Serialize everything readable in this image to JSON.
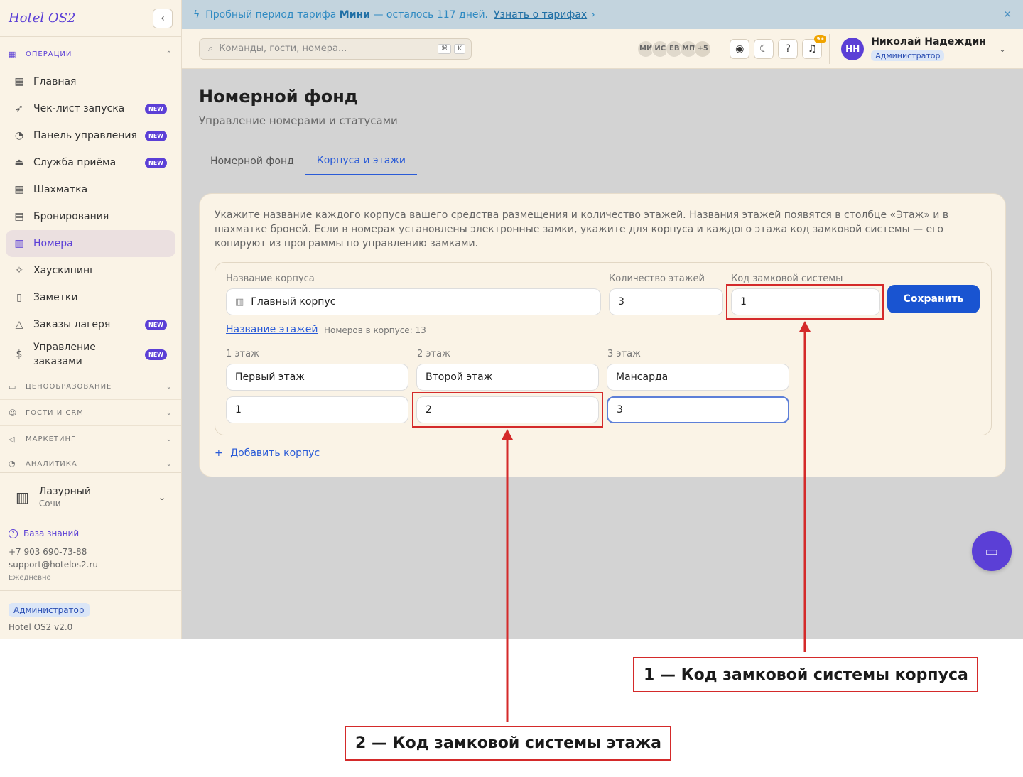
{
  "sidebar": {
    "logo": "Hotel OS2",
    "collapse_icon": "chevron-left-icon",
    "sections": {
      "operations": "ОПЕРАЦИИ",
      "pricing": "ЦЕНООБРАЗОВАНИЕ",
      "guests": "ГОСТИ И CRM",
      "marketing": "МАРКЕТИНГ",
      "analytics": "АНАЛИТИКА"
    },
    "items": [
      {
        "label": "Главная",
        "icon": "grid-icon",
        "badge": ""
      },
      {
        "label": "Чек-лист запуска",
        "icon": "rocket-icon",
        "badge": "NEW"
      },
      {
        "label": "Панель управления",
        "icon": "gauge-icon",
        "badge": "NEW"
      },
      {
        "label": "Служба приёма",
        "icon": "bell-desk-icon",
        "badge": "NEW"
      },
      {
        "label": "Шахматка",
        "icon": "table-icon",
        "badge": ""
      },
      {
        "label": "Бронирования",
        "icon": "clipboard-icon",
        "badge": ""
      },
      {
        "label": "Номера",
        "icon": "building-icon",
        "badge": ""
      },
      {
        "label": "Хаускипинг",
        "icon": "sparkle-icon",
        "badge": ""
      },
      {
        "label": "Заметки",
        "icon": "note-icon",
        "badge": ""
      },
      {
        "label": "Заказы лагеря",
        "icon": "tent-icon",
        "badge": "NEW"
      },
      {
        "label": "Управление заказами",
        "icon": "dollar-doc-icon",
        "badge": "NEW"
      }
    ],
    "hotel": {
      "name": "Лазурный",
      "city": "Сочи"
    },
    "support": {
      "kb": "База знаний",
      "phone": "+7 903 690-73-88",
      "email": "support@hotelos2.ru",
      "schedule": "Ежедневно"
    },
    "role": "Администратор",
    "version": "Hotel OS2 v2.0"
  },
  "banner": {
    "text_pre": "Пробный период тарифа ",
    "plan": "Мини",
    "text_post": " — осталось 117 дней.",
    "link": "Узнать о тарифах",
    "link_arrow": "›",
    "close": "✕"
  },
  "header": {
    "search_placeholder": "Команды, гости, номера...",
    "kbd1": "⌘",
    "kbd2": "K",
    "avatars": [
      "МИ",
      "ИС",
      "ЕВ",
      "МП",
      "+5"
    ],
    "notif_count": "9+",
    "user_initials": "НН",
    "user_name": "Николай Надеждин",
    "user_role": "Администратор"
  },
  "page": {
    "title": "Номерной фонд",
    "subtitle": "Управление номерами и статусами",
    "tabs": [
      "Номерной фонд",
      "Корпуса и этажи"
    ],
    "active_tab": 1
  },
  "card": {
    "description": "Укажите название каждого корпуса вашего средства размещения и количество этажей. Названия этажей появятся в столбце «Этаж» и в шахматке броней. Если в номерах установлены электронные замки, укажите для корпуса и каждого этажа код замковой системы — его копируют из программы по управлению замками.",
    "building": {
      "name_label": "Название корпуса",
      "name_value": "Главный корпус",
      "floors_label": "Количество этажей",
      "floors_value": "3",
      "lock_label": "Код замковой системы",
      "lock_value": "1",
      "save": "Сохранить",
      "floors_link": "Название этажей",
      "room_count": "Номеров в корпусе: 13",
      "floors": [
        {
          "label": "1 этаж",
          "name": "Первый этаж",
          "code": "1"
        },
        {
          "label": "2 этаж",
          "name": "Второй этаж",
          "code": "2"
        },
        {
          "label": "3 этаж",
          "name": "Мансарда",
          "code": "3"
        }
      ]
    },
    "add_building": "Добавить корпус"
  },
  "annotations": {
    "callout1": "1 — Код замковой системы корпуса",
    "callout2": "2 — Код замковой системы этажа",
    "color": "#d42a2a"
  },
  "colors": {
    "accent": "#5b3fd6",
    "primary_button": "#1954d1",
    "link": "#2a5bd7"
  }
}
